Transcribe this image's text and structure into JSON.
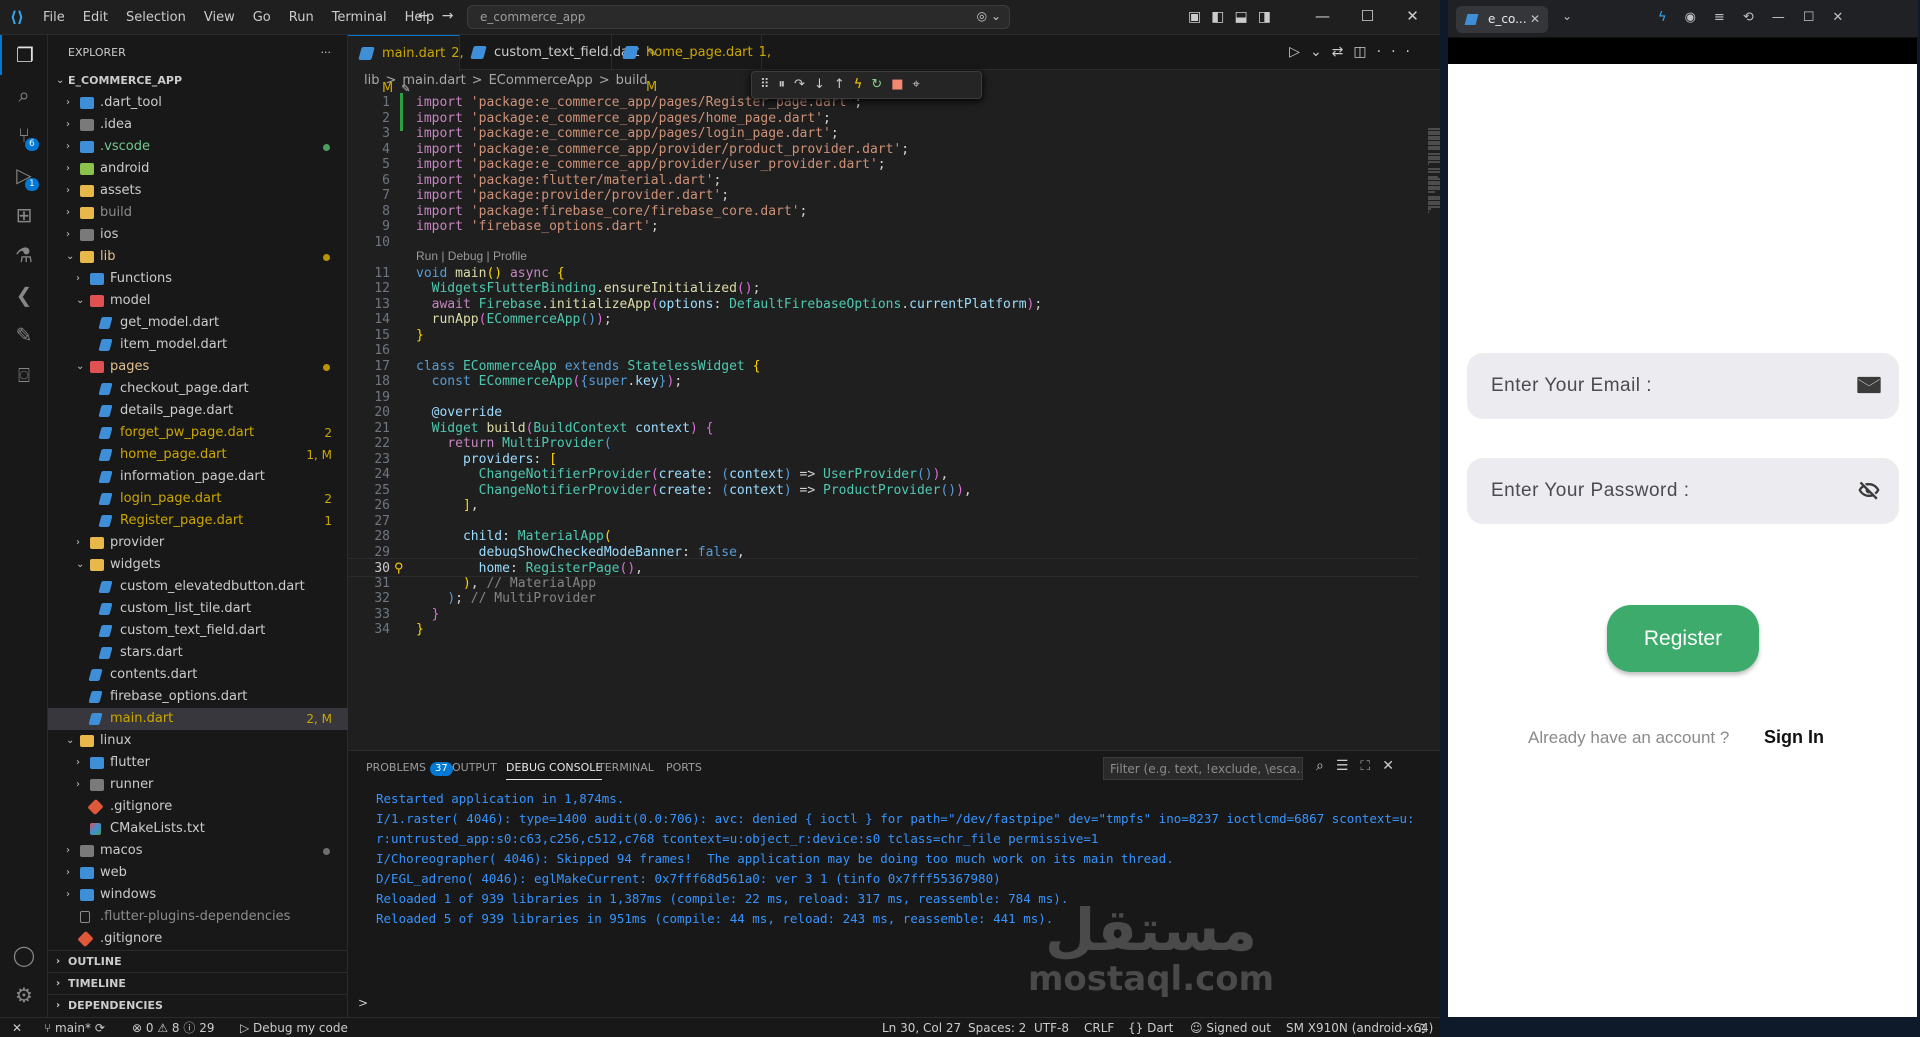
{
  "titlebar": {
    "menu": [
      "File",
      "Edit",
      "Selection",
      "View",
      "Go",
      "Run",
      "Terminal",
      "Help"
    ],
    "command_center": "e_commerce_app",
    "logo_icon": "vscode-logo-icon"
  },
  "activitybar": {
    "scm_badge": "6",
    "debug_badge": "1"
  },
  "explorer": {
    "title": "EXPLORER",
    "root": "E_COMMERCE_APP",
    "items": [
      {
        "label": ".dart_tool",
        "depth": 1,
        "kind": "folder",
        "open": false,
        "status": "",
        "color": "#3e8ed8"
      },
      {
        "label": ".idea",
        "depth": 1,
        "kind": "folder",
        "open": false,
        "status": "",
        "color": "#7a7a7a"
      },
      {
        "label": ".vscode",
        "depth": 1,
        "kind": "folder",
        "open": false,
        "status": "dot",
        "dotcolor": "#4a9e5c",
        "color": "#3e8ed8",
        "textcolor": "#73c991"
      },
      {
        "label": "android",
        "depth": 1,
        "kind": "folder",
        "open": false,
        "status": "",
        "color": "#8bc34a"
      },
      {
        "label": "assets",
        "depth": 1,
        "kind": "folder",
        "open": false,
        "status": "",
        "color": "#e8b84a"
      },
      {
        "label": "build",
        "depth": 1,
        "kind": "folder",
        "open": false,
        "status": "",
        "color": "#e8b84a",
        "textcolor": "#8c8c8c"
      },
      {
        "label": "ios",
        "depth": 1,
        "kind": "folder",
        "open": false,
        "status": "",
        "color": "#7a7a7a"
      },
      {
        "label": "lib",
        "depth": 1,
        "kind": "folder",
        "open": true,
        "status": "dot",
        "dotcolor": "#b89500",
        "color": "#e8b84a",
        "textcolor": "#e2c08d"
      },
      {
        "label": "Functions",
        "depth": 2,
        "kind": "folder",
        "open": false,
        "status": "",
        "color": "#3e8ed8"
      },
      {
        "label": "model",
        "depth": 2,
        "kind": "folder",
        "open": true,
        "status": "",
        "color": "#e05252"
      },
      {
        "label": "get_model.dart",
        "depth": 3,
        "kind": "dart",
        "status": ""
      },
      {
        "label": "item_model.dart",
        "depth": 3,
        "kind": "dart",
        "status": ""
      },
      {
        "label": "pages",
        "depth": 2,
        "kind": "folder",
        "open": true,
        "status": "dot",
        "dotcolor": "#b89500",
        "color": "#e05252",
        "textcolor": "#e2c08d"
      },
      {
        "label": "checkout_page.dart",
        "depth": 3,
        "kind": "dart",
        "status": ""
      },
      {
        "label": "details_page.dart",
        "depth": 3,
        "kind": "dart",
        "status": ""
      },
      {
        "label": "forget_pw_page.dart",
        "depth": 3,
        "kind": "dart",
        "status": "2",
        "textcolor": "#cca700"
      },
      {
        "label": "home_page.dart",
        "depth": 3,
        "kind": "dart",
        "status": "1, M",
        "textcolor": "#cca700"
      },
      {
        "label": "information_page.dart",
        "depth": 3,
        "kind": "dart",
        "status": ""
      },
      {
        "label": "login_page.dart",
        "depth": 3,
        "kind": "dart",
        "status": "2",
        "textcolor": "#cca700"
      },
      {
        "label": "Register_page.dart",
        "depth": 3,
        "kind": "dart",
        "status": "1",
        "textcolor": "#cca700"
      },
      {
        "label": "provider",
        "depth": 2,
        "kind": "folder",
        "open": false,
        "status": "",
        "color": "#e8b84a"
      },
      {
        "label": "widgets",
        "depth": 2,
        "kind": "folder",
        "open": true,
        "status": "",
        "color": "#e8b84a"
      },
      {
        "label": "custom_elevatedbutton.dart",
        "depth": 3,
        "kind": "dart",
        "status": ""
      },
      {
        "label": "custom_list_tile.dart",
        "depth": 3,
        "kind": "dart",
        "status": ""
      },
      {
        "label": "custom_text_field.dart",
        "depth": 3,
        "kind": "dart",
        "status": ""
      },
      {
        "label": "stars.dart",
        "depth": 3,
        "kind": "dart",
        "status": ""
      },
      {
        "label": "contents.dart",
        "depth": 2,
        "kind": "dart",
        "status": ""
      },
      {
        "label": "firebase_options.dart",
        "depth": 2,
        "kind": "dart",
        "status": ""
      },
      {
        "label": "main.dart",
        "depth": 2,
        "kind": "dart",
        "status": "2, M",
        "textcolor": "#cca700",
        "selected": true
      },
      {
        "label": "linux",
        "depth": 1,
        "kind": "folder",
        "open": true,
        "status": "",
        "color": "#e8b84a"
      },
      {
        "label": "flutter",
        "depth": 2,
        "kind": "folder",
        "open": false,
        "status": "",
        "color": "#3e8ed8"
      },
      {
        "label": "runner",
        "depth": 2,
        "kind": "folder",
        "open": false,
        "status": "",
        "color": "#7a7a7a"
      },
      {
        "label": ".gitignore",
        "depth": 2,
        "kind": "git",
        "status": ""
      },
      {
        "label": "CMakeLists.txt",
        "depth": 2,
        "kind": "cmake",
        "status": ""
      },
      {
        "label": "macos",
        "depth": 1,
        "kind": "folder",
        "open": false,
        "status": "dot",
        "dotcolor": "#6e6e6e",
        "color": "#7a7a7a"
      },
      {
        "label": "web",
        "depth": 1,
        "kind": "folder",
        "open": false,
        "status": "",
        "color": "#3e8ed8"
      },
      {
        "label": "windows",
        "depth": 1,
        "kind": "folder",
        "open": false,
        "status": "",
        "color": "#3e8ed8"
      },
      {
        "label": ".flutter-plugins-dependencies",
        "depth": 1,
        "kind": "file",
        "status": "",
        "textcolor": "#8c8c8c"
      },
      {
        "label": ".gitignore",
        "depth": 1,
        "kind": "git",
        "status": ""
      }
    ],
    "sections": [
      "OUTLINE",
      "TIMELINE",
      "DEPENDENCIES"
    ]
  },
  "tabs": [
    {
      "label": "main.dart",
      "status": "2, M",
      "active": true,
      "pinned": true
    },
    {
      "label": "custom_text_field.dart",
      "status": "",
      "active": false,
      "pinned": true
    },
    {
      "label": "home_page.dart",
      "status": "1, M",
      "active": false,
      "pinned": false
    }
  ],
  "breadcrumb": [
    "lib",
    ">",
    "main.dart",
    ">",
    "ECommerceApp",
    ">",
    "build"
  ],
  "codelens": "Run | Debug | Profile",
  "code_lines": [
    {
      "n": "1",
      "h": "<span class='k2'>import</span> <span class='s'>'package:e_commerce_app/pages/Register_page.dart'</span>;"
    },
    {
      "n": "2",
      "h": "<span class='k2'>import</span> <span class='s'>'package:e_commerce_app/pages/home_page.dart'</span>;"
    },
    {
      "n": "3",
      "h": "<span class='k2'>import</span> <span class='s'>'package:e_commerce_app/pages/login_page.dart'</span>;"
    },
    {
      "n": "4",
      "h": "<span class='k2'>import</span> <span class='s'>'package:e_commerce_app/provider/product_provider.dart'</span>;"
    },
    {
      "n": "5",
      "h": "<span class='k2'>import</span> <span class='s'>'package:e_commerce_app/provider/user_provider.dart'</span>;"
    },
    {
      "n": "6",
      "h": "<span class='k2'>import</span> <span class='s'>'package:flutter/material.dart'</span>;"
    },
    {
      "n": "7",
      "h": "<span class='k2'>import</span> <span class='s'>'package:provider/provider.dart'</span>;"
    },
    {
      "n": "8",
      "h": "<span class='k2'>import</span> <span class='s'>'package:firebase_core/firebase_core.dart'</span>;"
    },
    {
      "n": "9",
      "h": "<span class='k2'>import</span> <span class='s'>'firebase_options.dart'</span>;"
    },
    {
      "n": "10",
      "h": ""
    },
    {
      "n": "11",
      "h": "<span class='k'>void</span> <span class='f'>main</span><span class='y'>()</span> <span class='k2'>async</span> <span class='y'>{</span>"
    },
    {
      "n": "12",
      "h": "  <span class='t'>WidgetsFlutterBinding</span>.<span class='f'>ensureInitialized</span><span class='pu'>()</span>;"
    },
    {
      "n": "13",
      "h": "  <span class='k2'>await</span> <span class='t'>Firebase</span>.<span class='f'>initializeApp</span><span class='pu'>(</span><span class='p'>options</span>: <span class='t'>DefaultFirebaseOptions</span>.<span class='p'>currentPlatform</span><span class='pu'>)</span>;"
    },
    {
      "n": "14",
      "h": "  <span class='f'>runApp</span><span class='pu'>(</span><span class='t'>ECommerceApp</span><span class='k'>()</span><span class='pu'>)</span>;"
    },
    {
      "n": "15",
      "h": "<span class='y'>}</span>"
    },
    {
      "n": "16",
      "h": ""
    },
    {
      "n": "17",
      "h": "<span class='k'>class</span> <span class='t'>ECommerceApp</span> <span class='k'>extends</span> <span class='t'>StatelessWidget</span> <span class='y'>{</span>"
    },
    {
      "n": "18",
      "h": "  <span class='k'>const</span> <span class='t'>ECommerceApp</span><span class='pu'>(</span><span class='k'>{</span><span class='k'>super</span>.<span class='p'>key</span><span class='k'>}</span><span class='pu'>)</span>;"
    },
    {
      "n": "19",
      "h": ""
    },
    {
      "n": "20",
      "h": "  <span class='p'>@override</span>"
    },
    {
      "n": "21",
      "h": "  <span class='t'>Widget</span> <span class='f'>build</span><span class='pu'>(</span><span class='t'>BuildContext</span> <span class='p'>context</span><span class='pu'>)</span> <span class='pu'>{</span>"
    },
    {
      "n": "22",
      "h": "    <span class='k2'>return</span> <span class='t'>MultiProvider</span><span class='k'>(</span>"
    },
    {
      "n": "23",
      "h": "      <span class='p'>providers</span>: <span class='y'>[</span>"
    },
    {
      "n": "24",
      "h": "        <span class='t'>ChangeNotifierProvider</span><span class='pu'>(</span><span class='p'>create</span>: <span class='k'>(</span><span class='p'>context</span><span class='k'>)</span> =&gt; <span class='t'>UserProvider</span><span class='k'>()</span><span class='pu'>)</span>,"
    },
    {
      "n": "25",
      "h": "        <span class='t'>ChangeNotifierProvider</span><span class='pu'>(</span><span class='p'>create</span>: <span class='k'>(</span><span class='p'>context</span><span class='k'>)</span> =&gt; <span class='t'>ProductProvider</span><span class='k'>()</span><span class='pu'>)</span>,"
    },
    {
      "n": "26",
      "h": "      <span class='y'>]</span>,"
    },
    {
      "n": "27",
      "h": ""
    },
    {
      "n": "28",
      "h": "      <span class='p'>child</span>: <span class='t'>MaterialApp</span><span class='y'>(</span>"
    },
    {
      "n": "29",
      "h": "        <span class='p'>debugShowCheckedModeBanner</span>: <span class='k'>false</span>,"
    },
    {
      "n": "30",
      "h": "        <span class='p'>home</span>: <span class='t'>RegisterPage</span><span class='pu'>()</span>,"
    },
    {
      "n": "31",
      "h": "      <span class='y'>)</span>, <span class='cm'>// MaterialApp</span>"
    },
    {
      "n": "32",
      "h": "    <span class='k'>)</span>; <span class='cm'>// MultiProvider</span>"
    },
    {
      "n": "33",
      "h": "  <span class='pu'>}</span>"
    },
    {
      "n": "34",
      "h": "<span class='y'>}</span>"
    }
  ],
  "panel": {
    "tabs": [
      {
        "label": "PROBLEMS",
        "badge": "37",
        "active": false
      },
      {
        "label": "OUTPUT",
        "badge": "",
        "active": false
      },
      {
        "label": "DEBUG CONSOLE",
        "badge": "",
        "active": true
      },
      {
        "label": "TERMINAL",
        "badge": "",
        "active": false
      },
      {
        "label": "PORTS",
        "badge": "",
        "active": false
      }
    ],
    "filter_placeholder": "Filter (e.g. text, !exclude, \\esca...",
    "output": [
      "Restarted application in 1,874ms.",
      "I/1.raster( 4046): type=1400 audit(0.0:706): avc: denied { ioctl } for path=\"/dev/fastpipe\" dev=\"tmpfs\" ino=8237 ioctlcmd=6867 scontext=u:r:untrusted_app:s0:c63,c256,c512,c768 tcontext=u:object_r:device:s0 tclass=chr_file permissive=1",
      "I/Choreographer( 4046): Skipped 94 frames!  The application may be doing too much work on its main thread.",
      "D/EGL_adreno( 4046): eglMakeCurrent: 0x7fff68d561a0: ver 3 1 (tinfo 0x7fff55367980)",
      "Reloaded 1 of 939 libraries in 1,387ms (compile: 22 ms, reload: 317 ms, reassemble: 784 ms).",
      "Reloaded 5 of 939 libraries in 951ms (compile: 44 ms, reload: 243 ms, reassemble: 441 ms)."
    ],
    "prompt": ">"
  },
  "watermark": {
    "arabic": "مستقل",
    "latin": "mostaql.com"
  },
  "statusbar": {
    "branch": "main*",
    "errors": "0",
    "warnings": "8",
    "infos": "29",
    "debug": "Debug my code",
    "position": "Ln 30, Col 27",
    "spaces": "Spaces: 2",
    "encoding": "UTF-8",
    "eol": "CRLF",
    "language": "Dart",
    "account": "Signed out",
    "device": "SM X910N (android-x64)"
  },
  "emulator": {
    "tab_title": "e_co...",
    "email_placeholder": "Enter Your Email :",
    "password_placeholder": "Enter Your Password :",
    "register_label": "Register",
    "already_text": "Already have an account ?",
    "signin_label": "Sign In",
    "accent": "#3cab6b"
  }
}
